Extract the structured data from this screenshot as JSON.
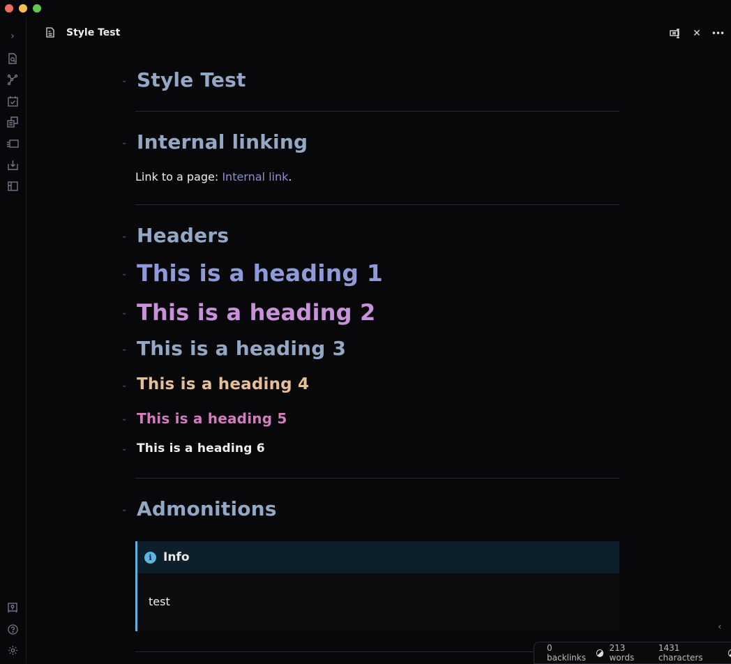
{
  "window": {
    "traffic_colors": [
      "#ec6a5e",
      "#f4bf4f",
      "#61c554"
    ]
  },
  "tab": {
    "title": "Style Test"
  },
  "ribbon": {
    "icons": [
      "expand-icon",
      "search-file-icon",
      "graph-icon",
      "daily-note-icon",
      "templates-icon",
      "slides-icon",
      "import-icon",
      "layout-icon"
    ],
    "bottom_icons": [
      "vault-icon",
      "help-icon",
      "settings-icon"
    ]
  },
  "doc": {
    "title": "Style Test",
    "section_internal": "Internal linking",
    "link_prefix": "Link to a page: ",
    "link_text": "Internal link",
    "link_suffix": ".",
    "section_headers": "Headers",
    "headings": [
      "This is a heading 1",
      "This is a heading 2",
      "This is a heading 3",
      "This is a heading 4",
      "This is a heading 5",
      "This is a heading 6"
    ],
    "section_admonitions": "Admonitions",
    "callout": {
      "title": "Info",
      "body": "test"
    }
  },
  "status": {
    "backlinks": "0 backlinks",
    "words": "213 words",
    "characters": "1431 characters"
  }
}
